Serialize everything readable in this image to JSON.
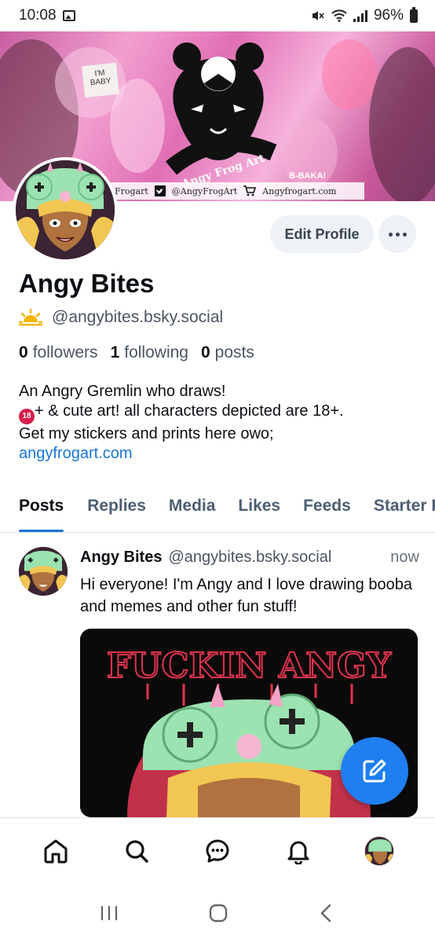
{
  "status_bar": {
    "time": "10:08",
    "battery": "96%"
  },
  "banner": {
    "logo_text": "Angy Frog Art",
    "footer_name": "Frogart",
    "twitter_handle": "@AngyFrogArt",
    "shop_url": "Angyfrogart.com",
    "sign_im": "I'M",
    "sign_baby": "BABY",
    "sign_baka": "B-BAKA!"
  },
  "profile": {
    "edit_label": "Edit Profile",
    "display_name": "Angy Bites",
    "handle": "@angybites.bsky.social",
    "followers_count": "0",
    "followers_label": "followers",
    "following_count": "1",
    "following_label": "following",
    "posts_count": "0",
    "posts_label": "posts",
    "bio_line1": "An Angry Gremlin who draws!",
    "bio_age_badge": "18",
    "bio_line2": "+ & cute art! all characters depicted are 18+.",
    "bio_line3": "Get my stickers and prints here owo;",
    "bio_link": "angyfrogart.com"
  },
  "tabs": [
    "Posts",
    "Replies",
    "Media",
    "Likes",
    "Feeds",
    "Starter Packs"
  ],
  "post": {
    "author": "Angy Bites",
    "handle": "@angybites.bsky.social",
    "time": "now",
    "text": "Hi everyone! I'm Angy and I love drawing booba and memes and other fun stuff!",
    "image_text": "FUCKIN ANGY"
  },
  "colors": {
    "accent": "#1677d6",
    "fab": "#1f7ef0",
    "image_title": "#e0344f"
  }
}
